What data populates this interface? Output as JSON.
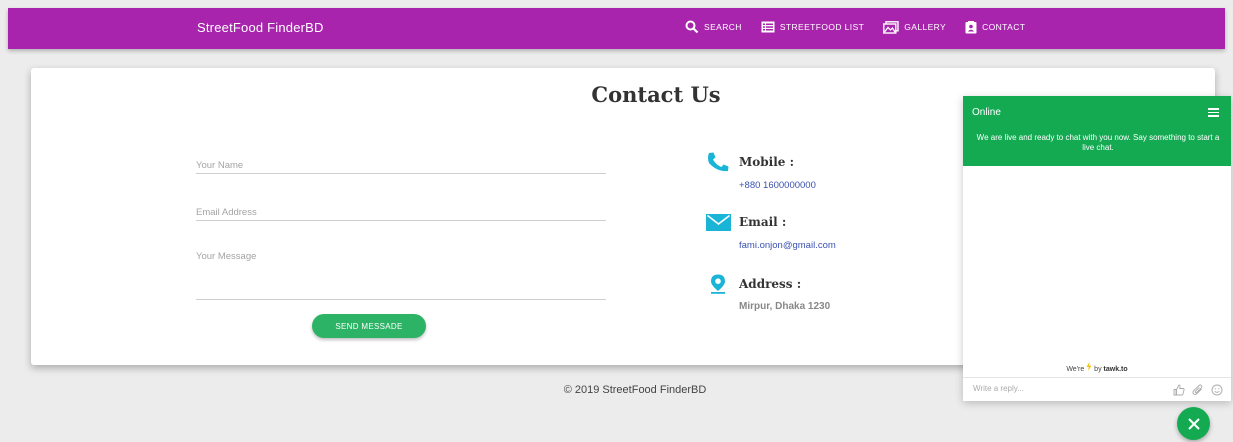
{
  "navbar": {
    "brand": "StreetFood FinderBD",
    "links": [
      {
        "label": "SEARCH",
        "icon": "search-icon"
      },
      {
        "label": "STREETFOOD LIST",
        "icon": "list-icon"
      },
      {
        "label": "GALLERY",
        "icon": "gallery-icon"
      },
      {
        "label": "CONTACT",
        "icon": "contact-icon"
      }
    ]
  },
  "contact": {
    "title": "Contact Us",
    "form": {
      "name_placeholder": "Your Name",
      "email_placeholder": "Email Address",
      "message_placeholder": "Your Message",
      "name_value": "",
      "email_value": "",
      "message_value": "",
      "send_label": "SEND MESSADE"
    },
    "info": {
      "mobile_label": "Mobile :",
      "mobile_value": "+880 1600000000",
      "email_label": "Email :",
      "email_value": "fami.onjon@gmail.com",
      "address_label": "Address :",
      "address_value": "Mirpur, Dhaka 1230"
    }
  },
  "footer": {
    "text": "© 2019 StreetFood FinderBD"
  },
  "chat": {
    "status": "Online",
    "message": "We are live and ready to chat with you now. Say something to start a live chat.",
    "brand_prefix": "We're",
    "brand_by": "by",
    "brand_name": "tawk.to",
    "input_placeholder": "Write a reply..."
  },
  "colors": {
    "navbar": "#a824ad",
    "accent_cyan": "#1ab5d6",
    "send_button": "#2db365",
    "chat_green": "#13aa52"
  }
}
